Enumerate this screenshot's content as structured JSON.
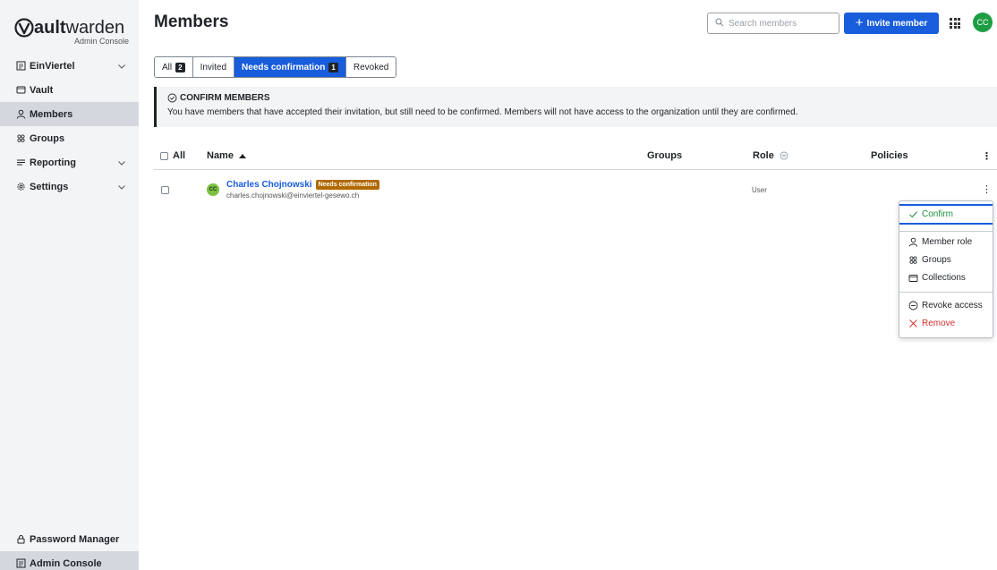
{
  "brand": {
    "name_bold": "ault",
    "name_rest": "warden",
    "subtitle": "Admin Console"
  },
  "sidebar": {
    "items": [
      {
        "label": "EinViertel",
        "icon": "org-icon",
        "chevron": true
      },
      {
        "label": "Vault",
        "icon": "vault-icon",
        "chevron": false
      },
      {
        "label": "Members",
        "icon": "user-icon",
        "chevron": false,
        "active": true
      },
      {
        "label": "Groups",
        "icon": "groups-icon",
        "chevron": false
      },
      {
        "label": "Reporting",
        "icon": "reporting-icon",
        "chevron": true
      },
      {
        "label": "Settings",
        "icon": "gear-icon",
        "chevron": true
      }
    ],
    "bottom": [
      {
        "label": "Password Manager",
        "icon": "lock-icon"
      },
      {
        "label": "Admin Console",
        "icon": "org-icon",
        "active": true
      }
    ]
  },
  "header": {
    "title": "Members",
    "search_placeholder": "Search members",
    "invite_label": "Invite member",
    "avatar_initials": "CC"
  },
  "tabs": [
    {
      "label": "All",
      "count": "2"
    },
    {
      "label": "Invited",
      "count": ""
    },
    {
      "label": "Needs confirmation",
      "count": "1",
      "active": true
    },
    {
      "label": "Revoked",
      "count": ""
    }
  ],
  "callout": {
    "title": "CONFIRM MEMBERS",
    "text": "You have members that have accepted their invitation, but still need to be confirmed. Members will not have access to the organization until they are confirmed."
  },
  "table": {
    "headers": {
      "all": "All",
      "name": "Name",
      "groups": "Groups",
      "role": "Role",
      "policies": "Policies"
    },
    "rows": [
      {
        "initials": "CC",
        "name": "Charles Chojnowski",
        "badge": "Needs confirmation",
        "email": "charles.chojnowski@einviertel-gesewo.ch",
        "role": "User"
      }
    ]
  },
  "menu": {
    "items": [
      {
        "label": "Confirm",
        "icon": "check-icon"
      },
      {
        "label": "Member role",
        "icon": "user-icon"
      },
      {
        "label": "Groups",
        "icon": "groups-icon"
      },
      {
        "label": "Collections",
        "icon": "collections-icon"
      },
      {
        "label": "Revoke access",
        "icon": "revoke-icon"
      },
      {
        "label": "Remove",
        "icon": "close-icon"
      }
    ]
  },
  "colors": {
    "primary": "#175ddc",
    "success": "#1e8e3e",
    "danger": "#d32f2f",
    "badge": "#b06a00"
  }
}
